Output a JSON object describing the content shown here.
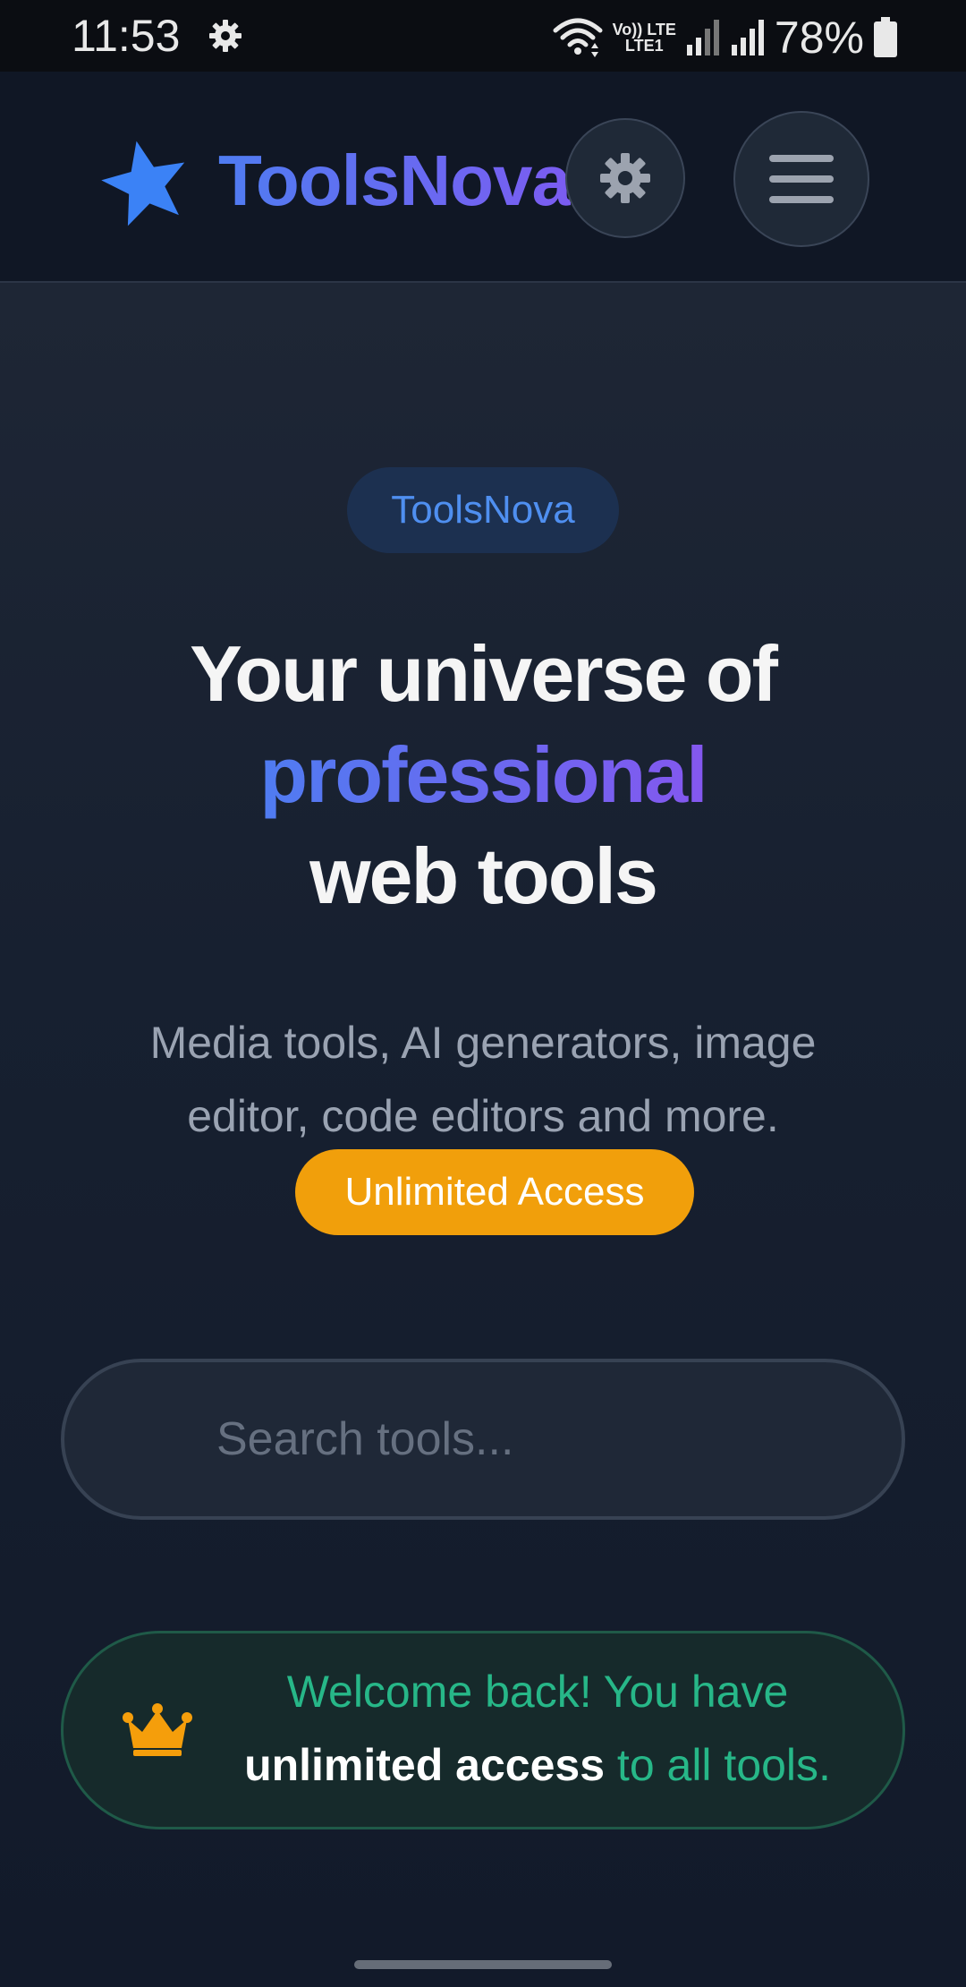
{
  "status_bar": {
    "time": "11:53",
    "network_label_top": "Vo)) LTE",
    "network_label_bottom": "LTE1",
    "battery_percent": "78%"
  },
  "header": {
    "app_name": "ToolsNova",
    "logo_icon": "star-icon",
    "theme_button_icon": "gear-icon",
    "menu_button_icon": "hamburger-menu-icon",
    "brand_gradient": [
      "#4f7cf1",
      "#7b5cf1"
    ]
  },
  "hero": {
    "badge": "ToolsNova",
    "title_line1": "Your universe of",
    "title_accent": "professional",
    "title_line3": "web tools",
    "subtitle": "Media tools, AI generators, image editor, code editors and more.",
    "access_badge": "Unlimited Access"
  },
  "search": {
    "placeholder": "Search tools...",
    "value": ""
  },
  "welcome": {
    "icon": "crown-icon",
    "text_part1": "Welcome back! You have ",
    "text_strong": "unlimited access",
    "text_part2": " to all tools."
  },
  "colors": {
    "accent_orange": "#f19f0b",
    "success_green": "#27b788",
    "badge_blue": "#4f8ff0"
  }
}
